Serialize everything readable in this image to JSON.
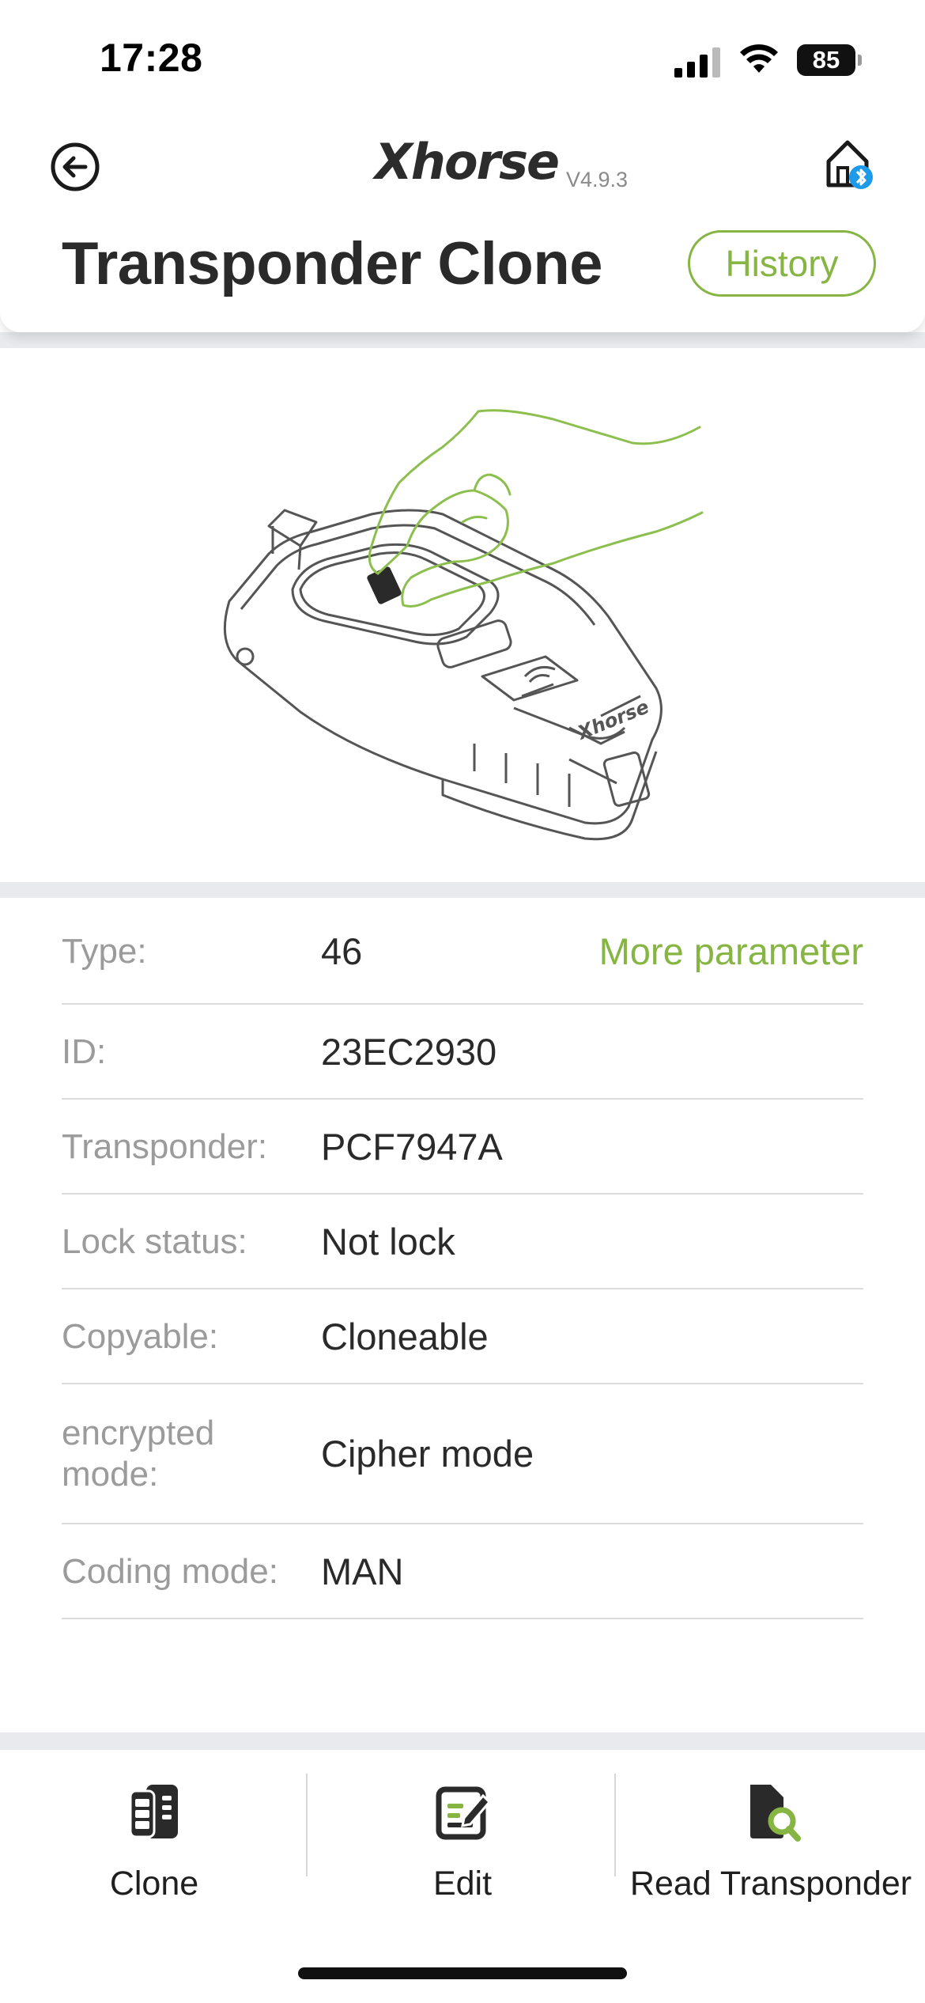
{
  "status_bar": {
    "time": "17:28",
    "battery": "85"
  },
  "header": {
    "brand": "Xhorse",
    "version": "V4.9.3",
    "title": "Transponder Clone",
    "history_label": "History"
  },
  "info_rows": [
    {
      "label": "Type:",
      "value": "46",
      "action": "More parameter"
    },
    {
      "label": "ID:",
      "value": "23EC2930"
    },
    {
      "label": "Transponder:",
      "value": "PCF7947A"
    },
    {
      "label": "Lock status:",
      "value": "Not lock"
    },
    {
      "label": "Copyable:",
      "value": "Cloneable"
    },
    {
      "label": "encrypted mode:",
      "value": "Cipher mode"
    },
    {
      "label": "Coding mode:",
      "value": "MAN"
    }
  ],
  "bottom_nav": [
    {
      "label": "Clone",
      "icon": "key-fob-icon"
    },
    {
      "label": "Edit",
      "icon": "edit-icon"
    },
    {
      "label": "Read Transponder",
      "icon": "read-transponder-icon"
    }
  ],
  "colors": {
    "accent": "#86b544",
    "divider": "#e8eaee",
    "label": "#9b9b9b"
  }
}
